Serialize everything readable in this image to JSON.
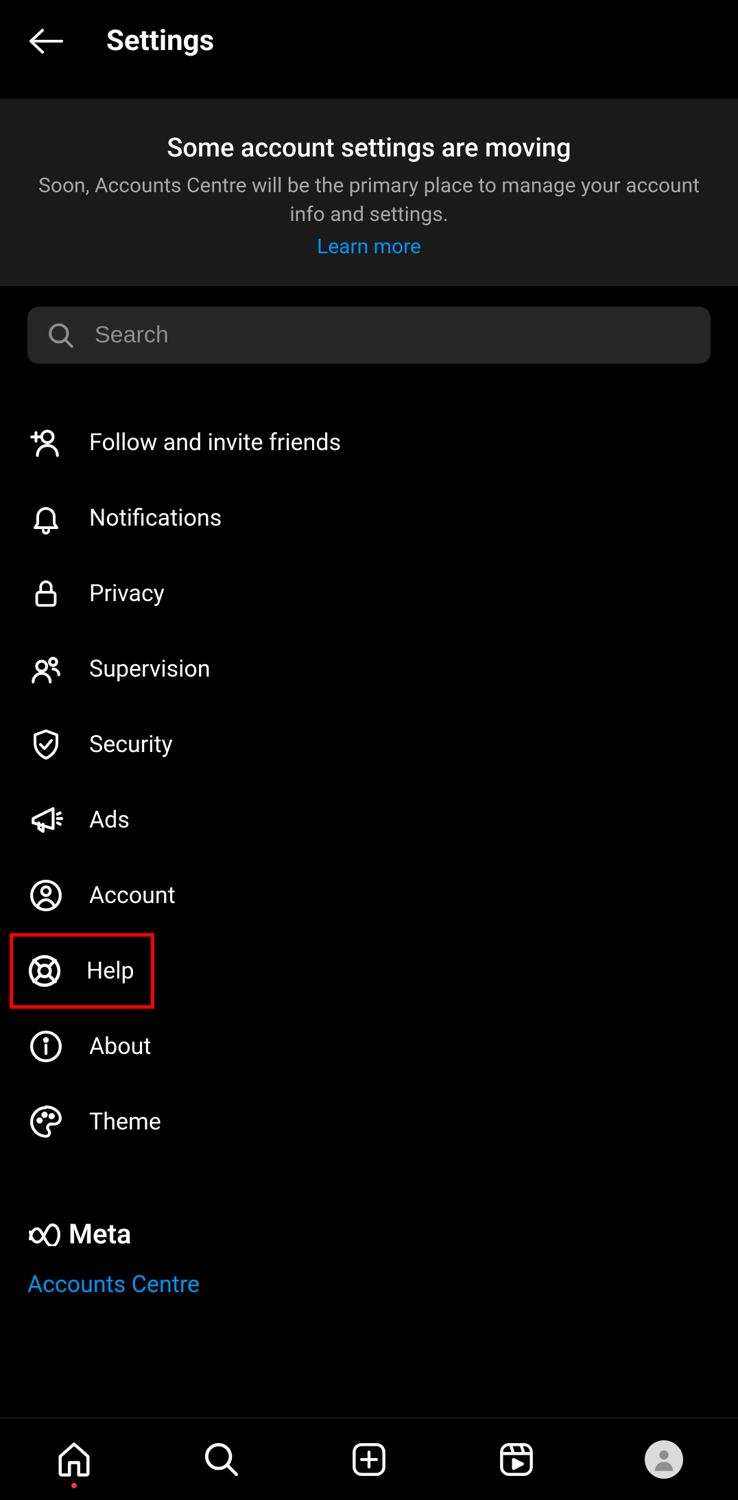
{
  "header": {
    "title": "Settings"
  },
  "banner": {
    "title": "Some account settings are moving",
    "subtitle": "Soon, Accounts Centre will be the primary place to manage your account info and settings.",
    "link_label": "Learn more"
  },
  "search": {
    "placeholder": "Search"
  },
  "menu": {
    "items": [
      {
        "icon": "person-add",
        "label": "Follow and invite friends"
      },
      {
        "icon": "bell",
        "label": "Notifications"
      },
      {
        "icon": "lock",
        "label": "Privacy"
      },
      {
        "icon": "people",
        "label": "Supervision"
      },
      {
        "icon": "shield-check",
        "label": "Security"
      },
      {
        "icon": "megaphone",
        "label": "Ads"
      },
      {
        "icon": "user-circle",
        "label": "Account"
      },
      {
        "icon": "lifebuoy",
        "label": "Help",
        "highlighted": true
      },
      {
        "icon": "info",
        "label": "About"
      },
      {
        "icon": "palette",
        "label": "Theme"
      }
    ]
  },
  "meta": {
    "brand": "Meta",
    "accounts_centre_label": "Accounts Centre"
  }
}
